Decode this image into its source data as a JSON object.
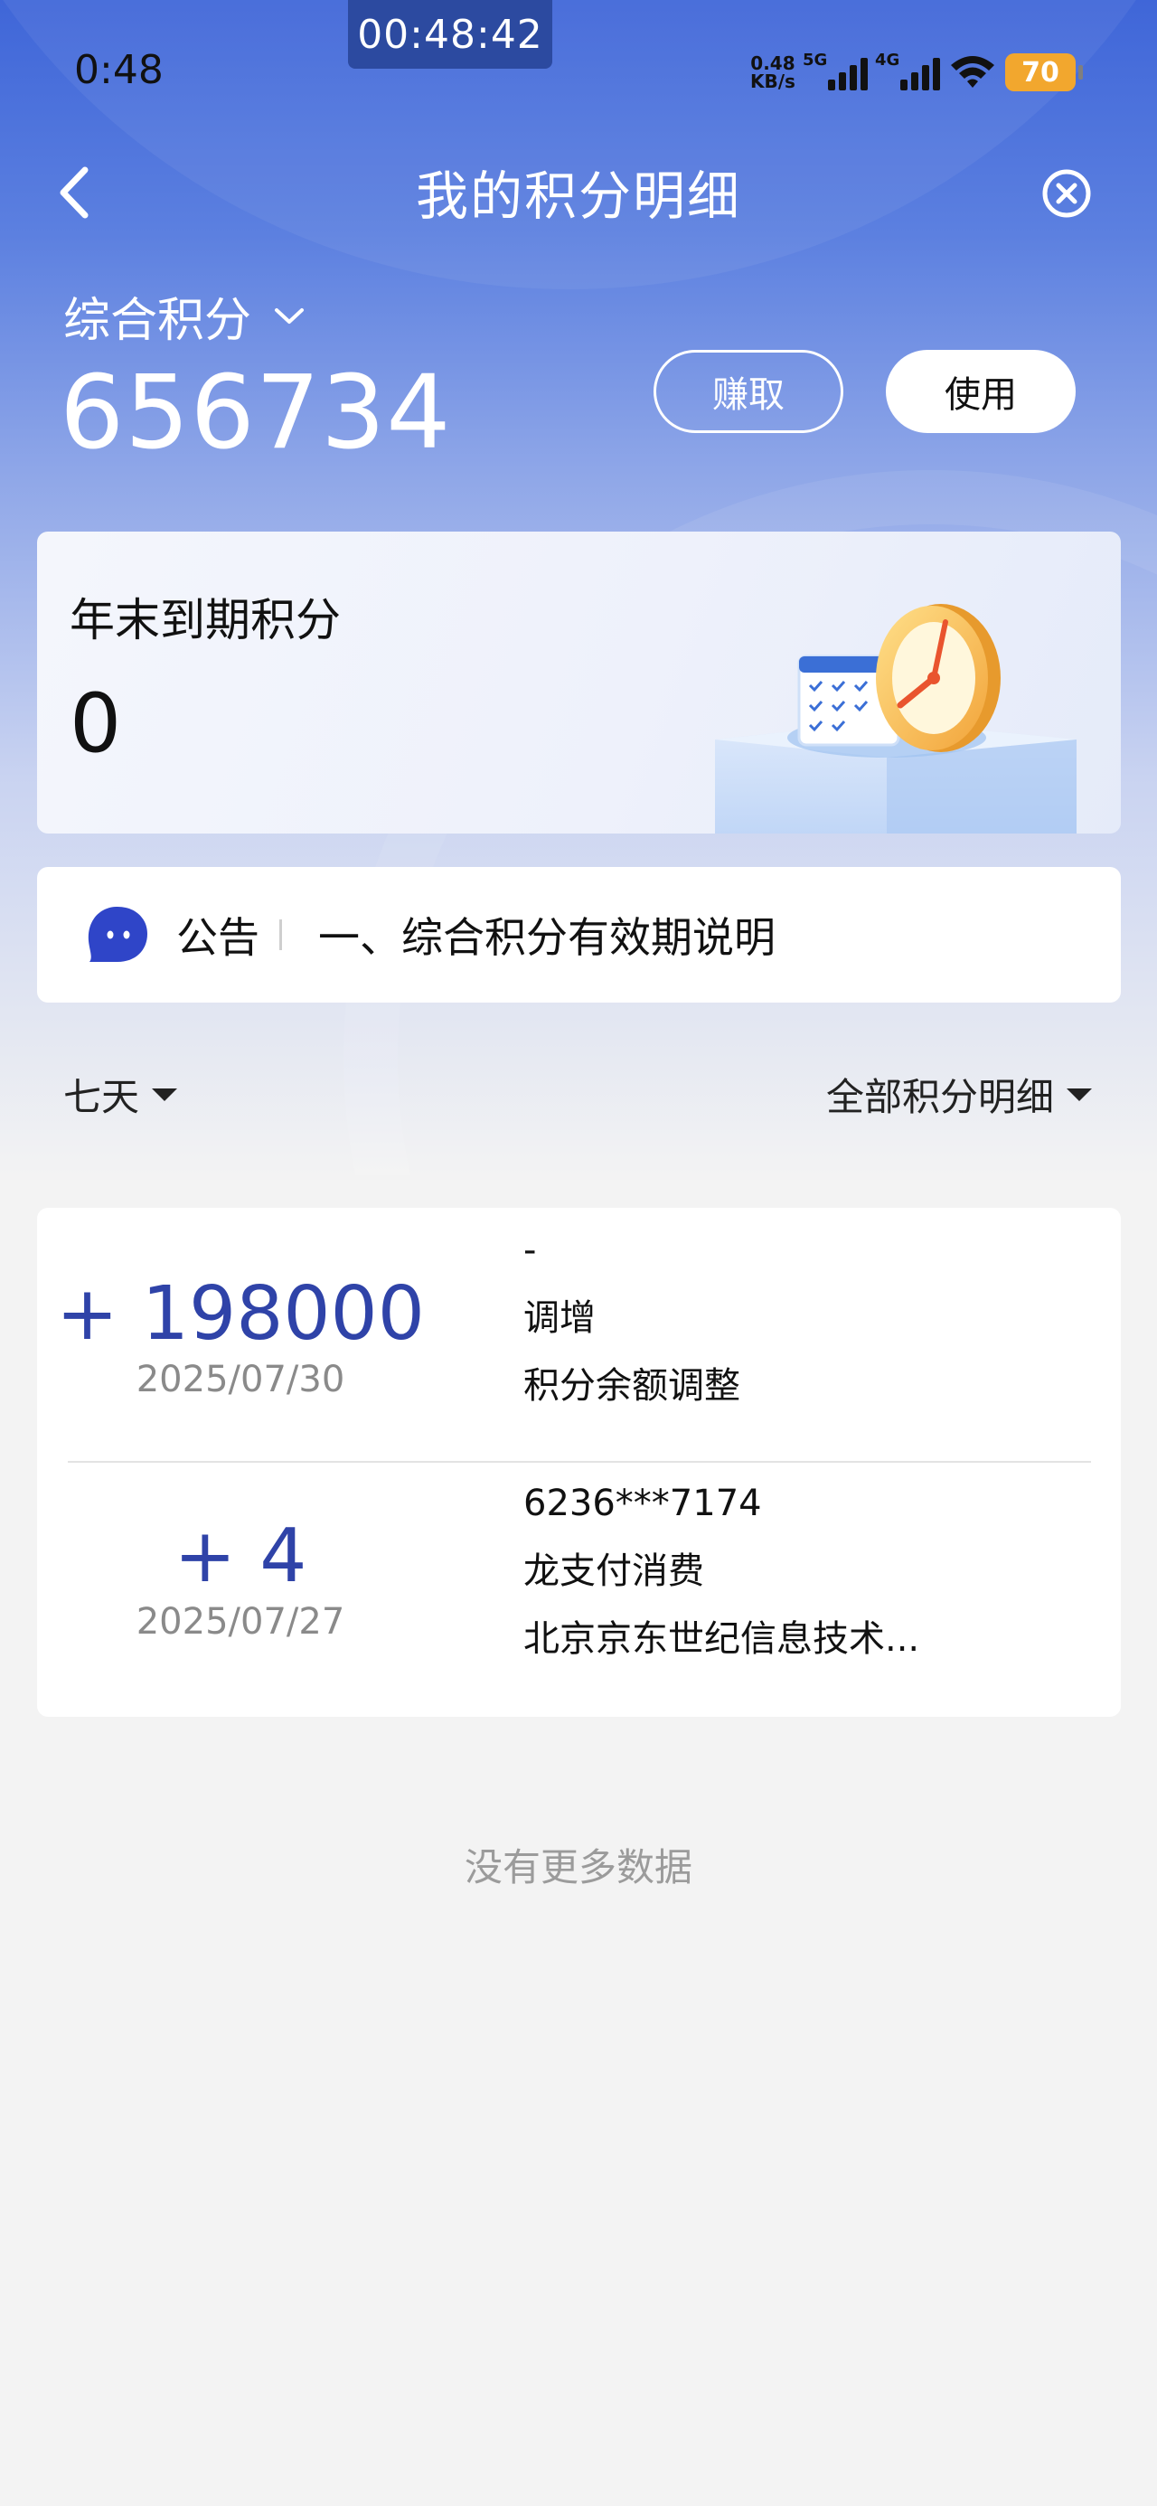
{
  "recording": {
    "timer": "00:48:42"
  },
  "status_bar": {
    "time": "0:48",
    "net_speed_value": "0.48",
    "net_speed_unit": "KB/s",
    "signal1_label": "5G",
    "signal2_label": "4G",
    "battery": "70",
    "icons": [
      "signal-5g-icon",
      "signal-4g-icon",
      "wifi-icon",
      "battery-icon"
    ]
  },
  "header": {
    "title": "我的积分明细",
    "back_icon": "chevron-left-icon",
    "close_icon": "close-circle-icon"
  },
  "points": {
    "label": "综合积分",
    "value": "656734",
    "earn_label": "赚取",
    "use_label": "使用"
  },
  "expire_card": {
    "title": "年末到期积分",
    "value": "0"
  },
  "notice": {
    "tag": "公告",
    "text": "一、综合积分有效期说明"
  },
  "filters": {
    "period": "七天",
    "category": "全部积分明细"
  },
  "records": [
    {
      "amount": "+ 198000",
      "date": "2025/07/30",
      "lines": [
        "-",
        "调增",
        "积分余额调整"
      ]
    },
    {
      "amount": "+ 4",
      "date": "2025/07/27",
      "lines": [
        "6236***7174",
        "龙支付消费",
        "北京京东世纪信息技术..."
      ]
    }
  ],
  "footer": {
    "no_more": "没有更多数据"
  },
  "colors": {
    "brand_blue": "#3f66d8",
    "amount_blue": "#2f43a8",
    "battery_orange": "#f2a72e"
  }
}
